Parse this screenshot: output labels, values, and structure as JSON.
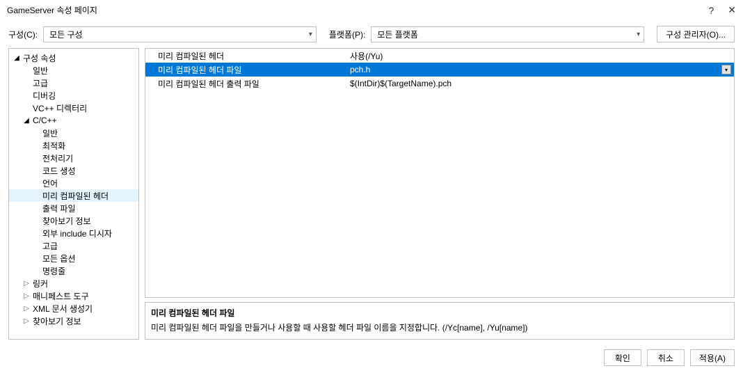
{
  "title": "GameServer 속성 페이지",
  "help_icon": "?",
  "close_icon": "✕",
  "top": {
    "config_label": "구성(C):",
    "config_value": "모든 구성",
    "platform_label": "플랫폼(P):",
    "platform_value": "모든 플랫폼",
    "manager_button": "구성 관리자(O)..."
  },
  "tree": {
    "root_label": "구성 속성",
    "items_l1": {
      "general": "일반",
      "advanced": "고급",
      "debugging": "디버깅",
      "vcdir": "VC++ 디렉터리"
    },
    "ccpp": {
      "label": "C/C++",
      "general": "일반",
      "optimization": "최적화",
      "preprocessor": "전처리기",
      "codegen": "코드 생성",
      "language": "언어",
      "precompiled": "미리 컴파일된 헤더",
      "output": "출력 파일",
      "browse": "찾아보기 정보",
      "external_include": "외부 include 디시자",
      "advanced": "고급",
      "all_options": "모든 옵션",
      "cmdline": "명령줄"
    },
    "collapsed": {
      "linker": "링커",
      "manifest": "매니페스트 도구",
      "xml": "XML 문서 생성기",
      "browse": "찾아보기 정보"
    }
  },
  "grid": {
    "rows": [
      {
        "name": "미리 컴파일된 헤더",
        "value": "사용(/Yu)"
      },
      {
        "name": "미리 컴파일된 헤더 파일",
        "value": "pch.h"
      },
      {
        "name": "미리 컴파일된 헤더 출력 파일",
        "value": "$(IntDir)$(TargetName).pch"
      }
    ]
  },
  "desc": {
    "title": "미리 컴파일된 헤더 파일",
    "body": "미리 컴파일된 헤더 파일을 만들거나 사용할 때 사용할 헤더 파일 이름을 지정합니다. (/Yc[name], /Yu[name])"
  },
  "footer": {
    "ok": "확인",
    "cancel": "취소",
    "apply": "적용(A)"
  }
}
